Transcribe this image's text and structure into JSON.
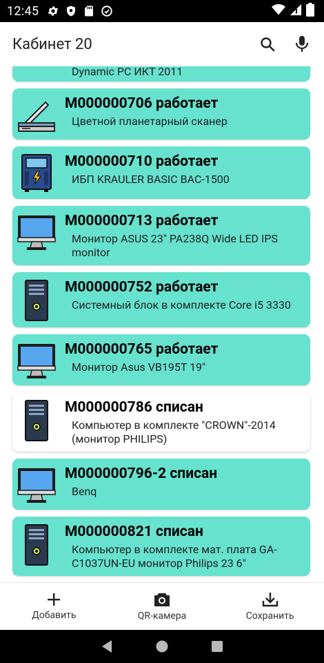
{
  "status": {
    "time": "12:45"
  },
  "app": {
    "title": "Кабинет 20"
  },
  "list": {
    "partial_text": "Dynamic PC ИКТ 2011",
    "items": [
      {
        "title": "M000000706 работает",
        "subtitle": "Цветной планетарный сканер",
        "icon": "scanner-icon",
        "style": "green"
      },
      {
        "title": "M000000710 работает",
        "subtitle": "ИБП KRAULER BASIC BAC-1500",
        "icon": "ups-icon",
        "style": "green"
      },
      {
        "title": "M000000713 работает",
        "subtitle": "Монитор ASUS 23\" PA238Q Wide LED IPS monitor",
        "icon": "monitor-icon",
        "style": "green"
      },
      {
        "title": "M000000752 работает",
        "subtitle": "Системный блок в комплекте  Core i5 3330",
        "icon": "pc-tower-icon",
        "style": "green"
      },
      {
        "title": "M000000765 работает",
        "subtitle": "Монитор Asus VB195T 19\"",
        "icon": "monitor-icon",
        "style": "green"
      },
      {
        "title": "M000000786 списан",
        "subtitle": "Компьютер в комплекте \"CROWN\"-2014 (монитор PHILIPS)",
        "icon": "pc-tower-icon",
        "style": "white"
      },
      {
        "title": "M000000796-2 списан",
        "subtitle": "Benq",
        "icon": "monitor-icon",
        "style": "green"
      },
      {
        "title": "M000000821 списан",
        "subtitle": "Компьютер в комплекте мат. плата GA-C1037UN-EU  монитор Philips 23 6\"",
        "icon": "pc-tower-icon",
        "style": "green"
      }
    ]
  },
  "bottom_nav": {
    "add_label": "Добавить",
    "qr_label": "QR-камера",
    "save_label": "Сохранить"
  },
  "colors": {
    "card_green": "#66e2cf",
    "card_white": "#ffffff"
  }
}
